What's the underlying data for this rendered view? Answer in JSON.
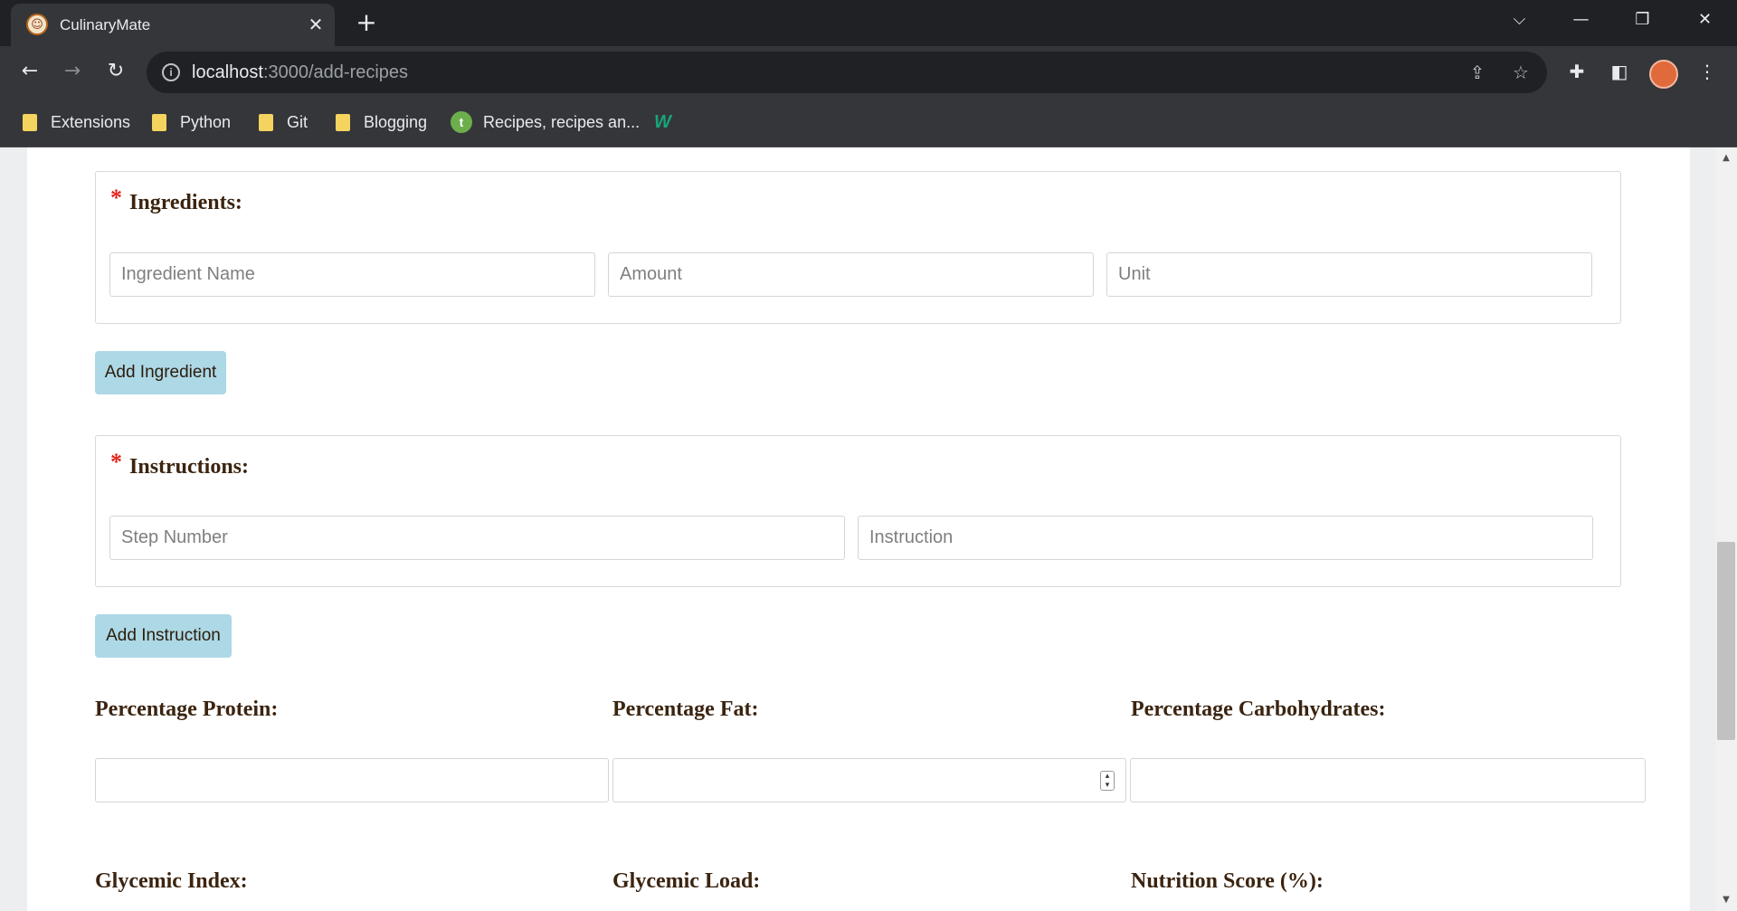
{
  "browser": {
    "tab_title": "CulinaryMate",
    "url_host": "localhost",
    "url_path": ":3000/add-recipes",
    "bookmarks": [
      {
        "label": "Extensions",
        "icon": "folder-icon"
      },
      {
        "label": "Python",
        "icon": "folder-icon"
      },
      {
        "label": "Git",
        "icon": "folder-icon"
      },
      {
        "label": "Blogging",
        "icon": "folder-icon"
      },
      {
        "label": "Recipes, recipes an...",
        "icon": "t-circle-icon",
        "icon_text": "t"
      },
      {
        "label": "",
        "icon": "w-logo-icon",
        "icon_text": "W"
      }
    ]
  },
  "form": {
    "ingredients": {
      "required_mark": "*",
      "title": "Ingredients:",
      "name_placeholder": "Ingredient Name",
      "amount_placeholder": "Amount",
      "unit_placeholder": "Unit",
      "add_button": "Add Ingredient"
    },
    "instructions": {
      "required_mark": "*",
      "title": "Instructions:",
      "step_placeholder": "Step Number",
      "instruction_placeholder": "Instruction",
      "add_button": "Add Instruction"
    },
    "nutrition": {
      "protein_label": "Percentage Protein:",
      "fat_label": "Percentage Fat:",
      "carbs_label": "Percentage Carbohydrates:",
      "glycemic_index_label": "Glycemic Index:",
      "glycemic_load_label": "Glycemic Load:",
      "nutrition_score_label": "Nutrition Score (%):"
    }
  },
  "colors": {
    "button_bg": "#add8e6",
    "required": "#e2241c",
    "label_text": "#3b2410"
  }
}
